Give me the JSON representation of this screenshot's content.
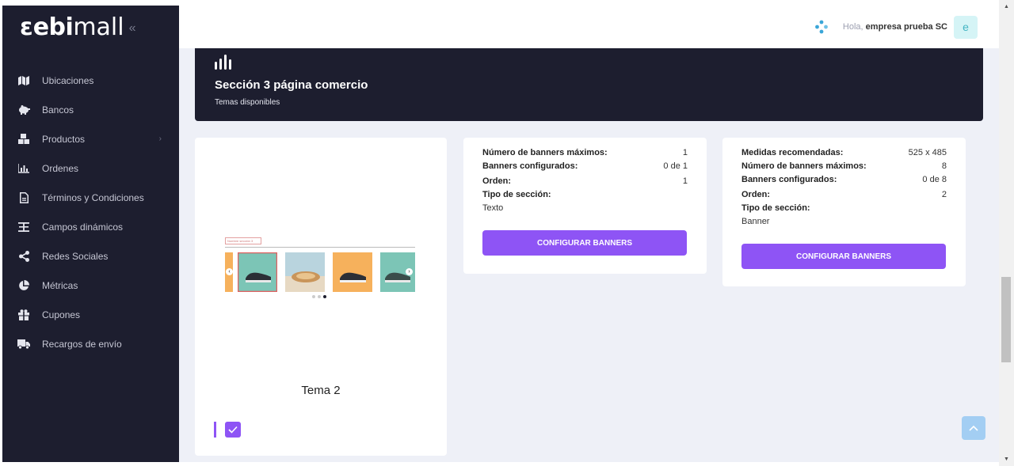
{
  "logo": {
    "mark": "ɛ",
    "bold": "ebi",
    "light": "mall",
    "collapse": "«"
  },
  "sidebar": {
    "items": [
      {
        "label": "Ubicaciones",
        "icon": "map-icon"
      },
      {
        "label": "Bancos",
        "icon": "piggy-bank-icon"
      },
      {
        "label": "Productos",
        "icon": "boxes-icon",
        "arrow": "›"
      },
      {
        "label": "Ordenes",
        "icon": "bar-chart-icon"
      },
      {
        "label": "Términos y Condiciones",
        "icon": "document-icon"
      },
      {
        "label": "Campos dinámicos",
        "icon": "text-height-icon"
      },
      {
        "label": "Redes Sociales",
        "icon": "share-icon"
      },
      {
        "label": "Métricas",
        "icon": "pie-chart-icon"
      },
      {
        "label": "Cupones",
        "icon": "gift-icon"
      },
      {
        "label": "Recargos de envío",
        "icon": "truck-icon"
      }
    ]
  },
  "topbar": {
    "greeting": "Hola,",
    "user_name": "empresa prueba SC",
    "avatar_letter": "e"
  },
  "header": {
    "title": "Sección 3 página comercio",
    "subtitle": "Temas disponibles"
  },
  "theme": {
    "name": "Tema 2",
    "preview_label": "Nombre sección 3"
  },
  "info_a": {
    "rows": [
      {
        "label": "Número de banners máximos:",
        "value": "1"
      },
      {
        "label": "Banners configurados:",
        "value": "0 de 1"
      },
      {
        "label": "Orden:",
        "value": "1"
      }
    ],
    "type_label": "Tipo de sección:",
    "type_value": "Texto",
    "button": "CONFIGURAR BANNERS"
  },
  "info_b": {
    "rows": [
      {
        "label": "Medidas recomendadas:",
        "value": "525 x 485"
      },
      {
        "label": "Número de banners máximos:",
        "value": "8"
      },
      {
        "label": "Banners configurados:",
        "value": "0 de 8"
      },
      {
        "label": "Orden:",
        "value": "2"
      }
    ],
    "type_label": "Tipo de sección:",
    "type_value": "Banner",
    "button": "CONFIGURAR BANNERS"
  },
  "colors": {
    "sidebar_bg": "#1d1e2f",
    "accent": "#8e54f5",
    "page_bg": "#eef0f7"
  }
}
